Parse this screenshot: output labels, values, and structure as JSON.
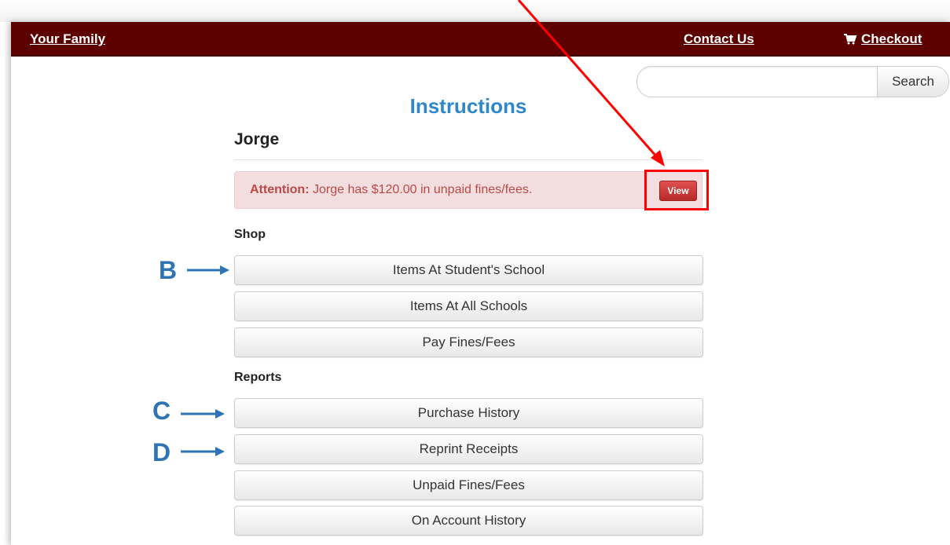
{
  "nav": {
    "family_label": "Your Family",
    "contact_label": "Contact Us",
    "checkout_label": "Checkout"
  },
  "search": {
    "value": "",
    "placeholder": "",
    "button_label": "Search"
  },
  "page_title": "Instructions",
  "student_name": "Jorge",
  "alert": {
    "strong": "Attention:",
    "message": " Jorge has $120.00 in unpaid fines/fees.",
    "button_label": "View"
  },
  "shop": {
    "label": "Shop",
    "items": [
      "Items At Student's School",
      "Items At All Schools",
      "Pay Fines/Fees"
    ]
  },
  "reports": {
    "label": "Reports",
    "items": [
      "Purchase History",
      "Reprint Receipts",
      "Unpaid Fines/Fees",
      "On Account History"
    ]
  },
  "callouts": {
    "b": "B",
    "c": "C",
    "d": "D"
  },
  "colors": {
    "navbar": "#5c0000",
    "title": "#2d87c8",
    "alert_bg": "#f2dede",
    "alert_text": "#b94a48",
    "callout": "#2e74b5",
    "annotation": "#ff0000"
  }
}
